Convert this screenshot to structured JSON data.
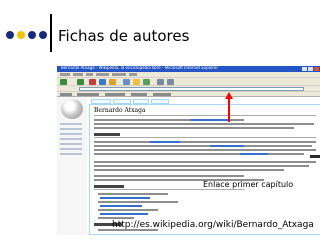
{
  "slide": {
    "title": "Fichas de autores",
    "dot_colors": [
      "#1a2a7a",
      "#f2c400",
      "#1a2a7a",
      "#1a2a7a"
    ]
  },
  "browser": {
    "window_title": "Bernardo Atxaga - Wikipedia, la enciclopedia libre - Microsoft Internet Explorer"
  },
  "article": {
    "heading": "Bernardo Atxaga",
    "section_heading": "Biografía"
  },
  "annotation": {
    "label": "Enlace primer capítulo",
    "color": "#ff0000"
  },
  "footer": {
    "url": "http://es.wikipedia.org/wiki/Bernardo_Atxaga"
  }
}
